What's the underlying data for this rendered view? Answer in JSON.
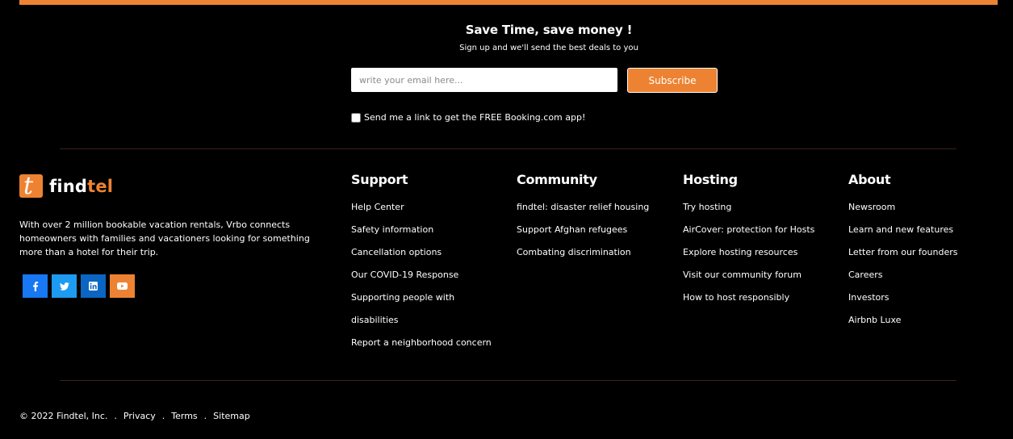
{
  "newsletter": {
    "title": "Save Time, save money !",
    "subtitle": "Sign up and we'll send the best deals to you",
    "email_placeholder": "write your email here...",
    "subscribe_label": "Subscribe",
    "app_link_label": "Send me a link to get the FREE Booking.com app!"
  },
  "brand": {
    "logo_glyph": "t",
    "name_prefix": "find",
    "name_accent": "tel",
    "description": "With over 2 million bookable vacation rentals, Vrbo connects homeowners with families and vacationers looking for something more than a hotel for their trip."
  },
  "social": [
    {
      "icon": "facebook-icon",
      "color": "#1877f2"
    },
    {
      "icon": "twitter-icon",
      "color": "#1d9bf0"
    },
    {
      "icon": "linkedin-icon",
      "color": "#0a66c2"
    },
    {
      "icon": "youtube-icon",
      "color": "#ed8332"
    }
  ],
  "columns": {
    "support": {
      "heading": "Support",
      "items": [
        "Help Center",
        "Safety information",
        "Cancellation options",
        "Our COVID-19 Response",
        "Supporting people with",
        "disabilities",
        "Report a neighborhood concern"
      ]
    },
    "community": {
      "heading": "Community",
      "items": [
        "findtel: disaster relief housing",
        "Support Afghan refugees",
        "Combating discrimination"
      ]
    },
    "hosting": {
      "heading": "Hosting",
      "items": [
        "Try hosting",
        "AirCover: protection for Hosts",
        "Explore hosting resources",
        "Visit our community forum",
        "How to host responsibly"
      ]
    },
    "about": {
      "heading": "About",
      "items": [
        "Newsroom",
        "Learn and new features",
        "Letter from our founders",
        "Careers",
        "Investors",
        "Airbnb Luxe"
      ]
    }
  },
  "legal": {
    "copyright": "© 2022 Findtel, Inc.",
    "separator": ".",
    "privacy": "Privacy",
    "terms": "Terms",
    "sitemap": "Sitemap"
  },
  "colors": {
    "accent": "#ed8332",
    "background": "#000000",
    "divider": "#3a2416"
  }
}
